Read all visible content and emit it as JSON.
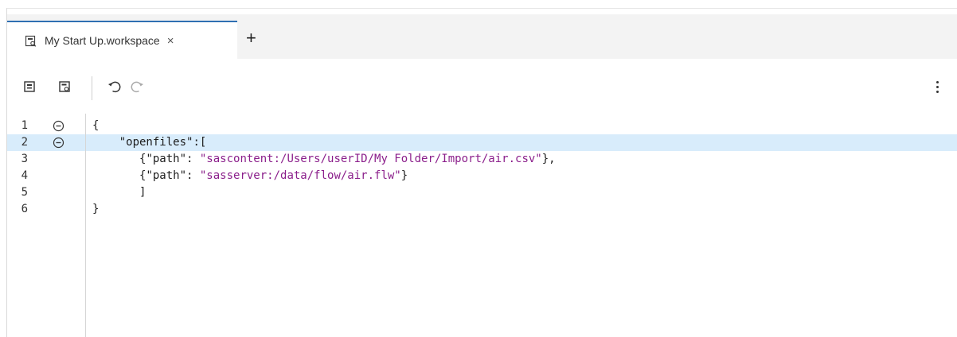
{
  "tabs": [
    {
      "label": "My Start Up.workspace",
      "close": "×",
      "icon": "workspace-icon"
    }
  ],
  "add_tab_label": "+",
  "toolbar": {
    "save_icon": "save-icon",
    "save_as_icon": "save-as-icon",
    "undo_icon": "undo-icon",
    "redo_icon": "redo-icon",
    "more_icon": "more-options-icon"
  },
  "editor": {
    "active_line": 2,
    "lines": [
      {
        "num": "1",
        "indent": "",
        "pre": "{",
        "str": "",
        "post": ""
      },
      {
        "num": "2",
        "indent": "    ",
        "pre": "",
        "str": "\"openfiles\"",
        "post": ":["
      },
      {
        "num": "3",
        "indent": "       ",
        "pre": "{\"path\": ",
        "str": "\"sascontent:/Users/userID/My Folder/Import/air.csv\"",
        "post": "},"
      },
      {
        "num": "4",
        "indent": "       ",
        "pre": "{\"path\": ",
        "str": "\"sasserver:/data/flow/air.flw\"",
        "post": "}"
      },
      {
        "num": "5",
        "indent": "       ",
        "pre": "]",
        "str": "",
        "post": ""
      },
      {
        "num": "6",
        "indent": "",
        "pre": "}",
        "str": "",
        "post": ""
      }
    ]
  },
  "colors": {
    "accent": "#2f6fb2",
    "active_line": "#d8ecfb",
    "string": "#8b1f8b"
  }
}
